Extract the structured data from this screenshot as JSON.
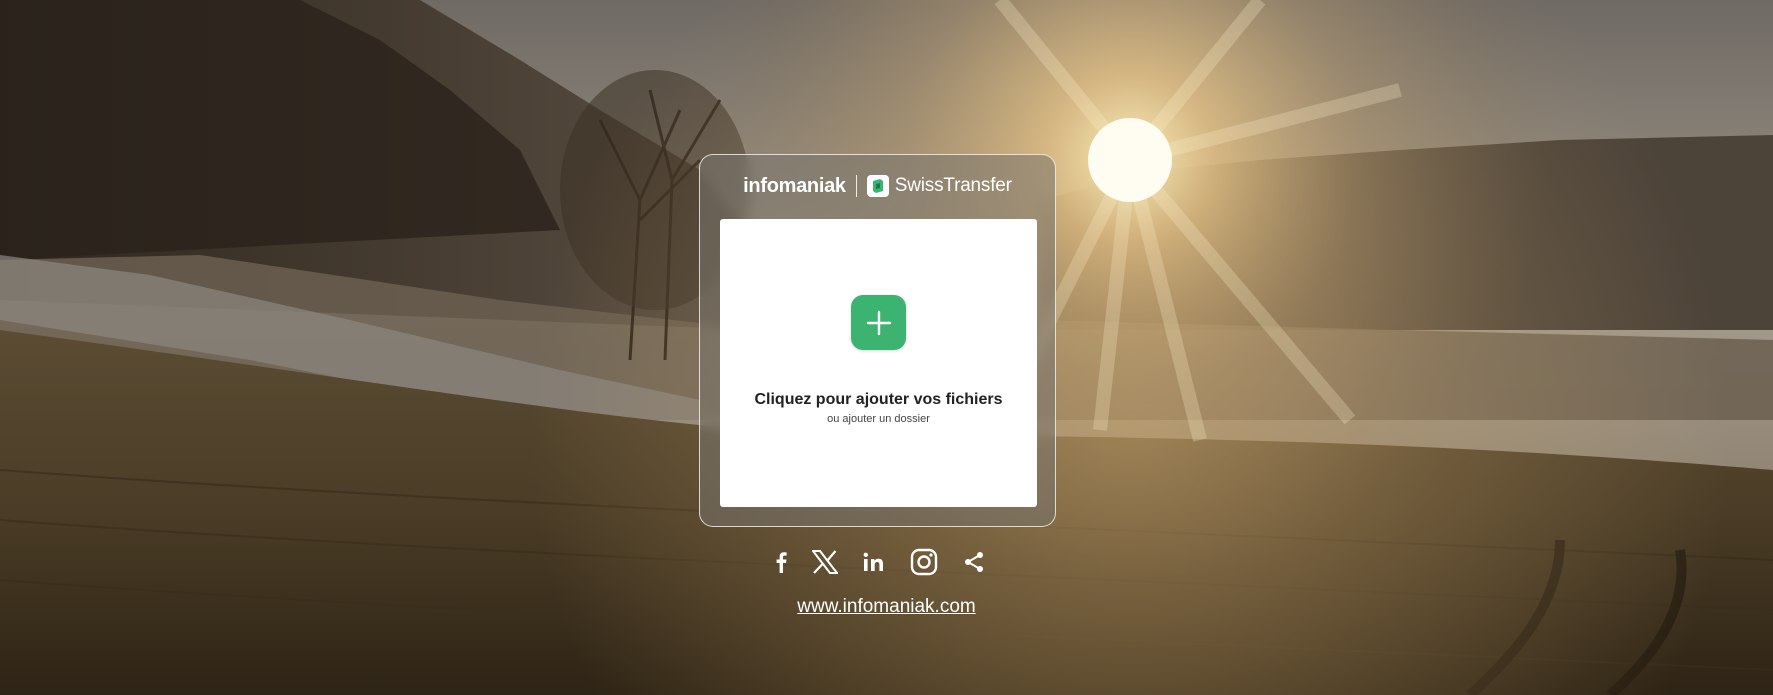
{
  "brand": {
    "company": "infomaniak",
    "product": "SwissTransfer",
    "logo_icon": "swisstransfer-logo-icon"
  },
  "dropzone": {
    "add_icon": "plus-icon",
    "title": "Cliquez pour ajouter vos fichiers",
    "subtitle": "ou ajouter un dossier"
  },
  "socials": [
    {
      "name": "facebook-icon"
    },
    {
      "name": "x-twitter-icon"
    },
    {
      "name": "linkedin-icon"
    },
    {
      "name": "instagram-icon"
    },
    {
      "name": "share-icon"
    }
  ],
  "footer": {
    "link": "www.infomaniak.com"
  },
  "colors": {
    "accent": "#3cb371",
    "text_dark": "#222222",
    "white": "#ffffff"
  }
}
